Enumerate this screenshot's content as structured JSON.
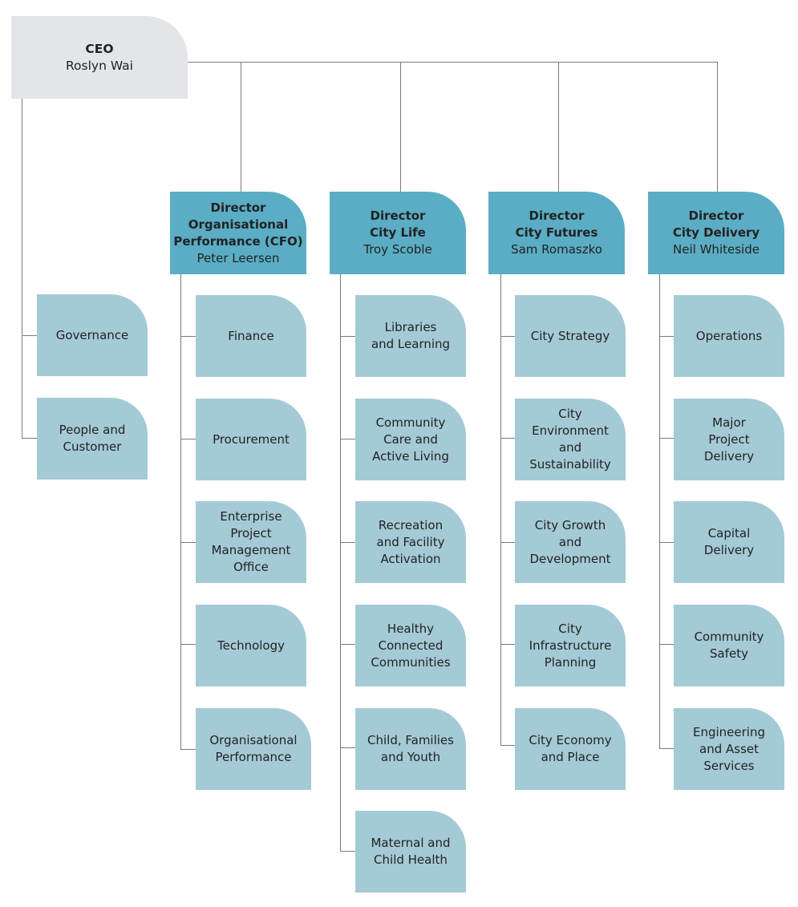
{
  "ceo": {
    "title": "CEO",
    "name": "Roslyn Wai"
  },
  "ceo_units": [
    {
      "label": "Governance"
    },
    {
      "label": "People and\nCustomer"
    }
  ],
  "directors": [
    {
      "title": "Director\nOrganisational\nPerformance (CFO)",
      "name": "Peter Leersen",
      "units": [
        {
          "label": "Finance"
        },
        {
          "label": "Procurement"
        },
        {
          "label": "Enterprise\nProject\nManagement\nOffice"
        },
        {
          "label": "Technology"
        },
        {
          "label": "Organisational\nPerformance"
        }
      ]
    },
    {
      "title": "Director\nCity Life",
      "name": "Troy Scoble",
      "units": [
        {
          "label": "Libraries\nand Learning"
        },
        {
          "label": "Community\nCare and\nActive Living"
        },
        {
          "label": "Recreation\nand Facility\nActivation"
        },
        {
          "label": "Healthy\nConnected\nCommunities"
        },
        {
          "label": "Child, Families\nand Youth"
        },
        {
          "label": "Maternal and\nChild Health"
        }
      ]
    },
    {
      "title": "Director\nCity Futures",
      "name": "Sam Romaszko",
      "units": [
        {
          "label": "City Strategy"
        },
        {
          "label": "City\nEnvironment\nand\nSustainability"
        },
        {
          "label": "City Growth\nand\nDevelopment"
        },
        {
          "label": "City\nInfrastructure\nPlanning"
        },
        {
          "label": "City Economy\nand Place"
        }
      ]
    },
    {
      "title": "Director\nCity Delivery",
      "name": "Neil Whiteside",
      "units": [
        {
          "label": "Operations"
        },
        {
          "label": "Major\nProject\nDelivery"
        },
        {
          "label": "Capital\nDelivery"
        },
        {
          "label": "Community\nSafety"
        },
        {
          "label": "Engineering\nand Asset\nServices"
        }
      ]
    }
  ],
  "colors": {
    "ceo_box": "#e3e5e8",
    "director_box": "#5aadc4",
    "unit_box": "#a4cad6",
    "connector": "#7a7a7a"
  }
}
